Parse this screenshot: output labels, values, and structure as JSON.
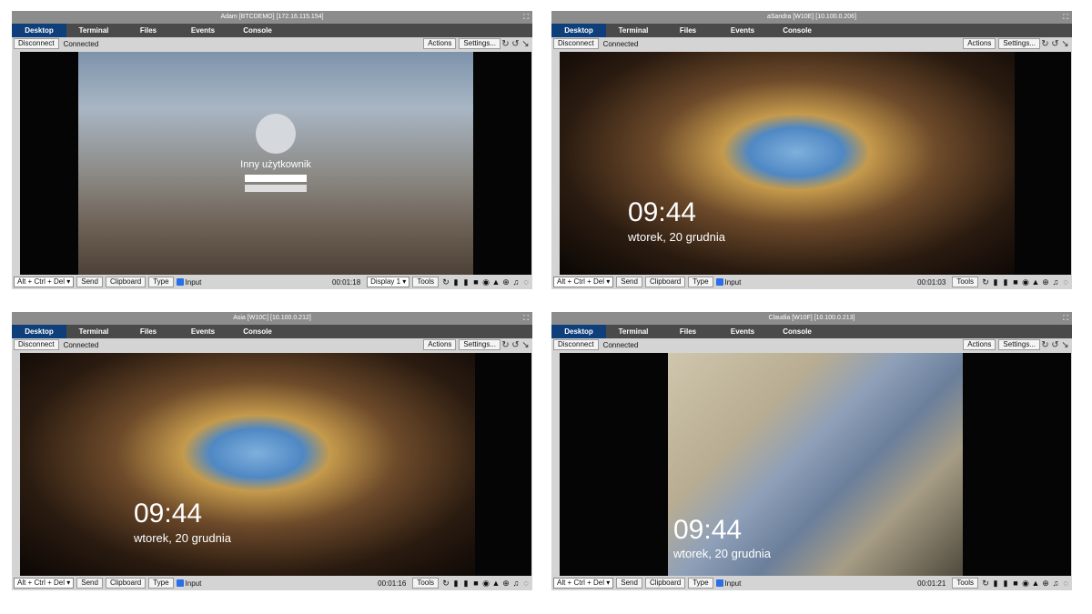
{
  "tabs": [
    "Desktop",
    "Terminal",
    "Files",
    "Events",
    "Console"
  ],
  "controls": {
    "disconnect": "Disconnect",
    "status": "Connected",
    "actions": "Actions",
    "settings": "Settings..."
  },
  "bottom": {
    "cad": "Alt + Ctrl + Del",
    "send": "Send",
    "clipboard": "Clipboard",
    "type": "Type",
    "input": "Input",
    "tools": "Tools"
  },
  "sessions": [
    {
      "title": "Adam [BTCDEMO]   [172.16.115.154]",
      "timer": "00:01:18",
      "display": "Display 1",
      "login_user": "Inny użytkownik"
    },
    {
      "title": "aSandra [W10E]   [10.100.0.206]",
      "timer": "00:01:03",
      "clock": "09:44",
      "date": "wtorek, 20 grudnia"
    },
    {
      "title": "Asia [W10C]   [10.100.0.212]",
      "timer": "00:01:16",
      "clock": "09:44",
      "date": "wtorek, 20 grudnia"
    },
    {
      "title": "Claudia [W10F]   [10.100.0.213]",
      "timer": "00:01:21",
      "clock": "09:44",
      "date": "wtorek, 20 grudnia"
    }
  ]
}
